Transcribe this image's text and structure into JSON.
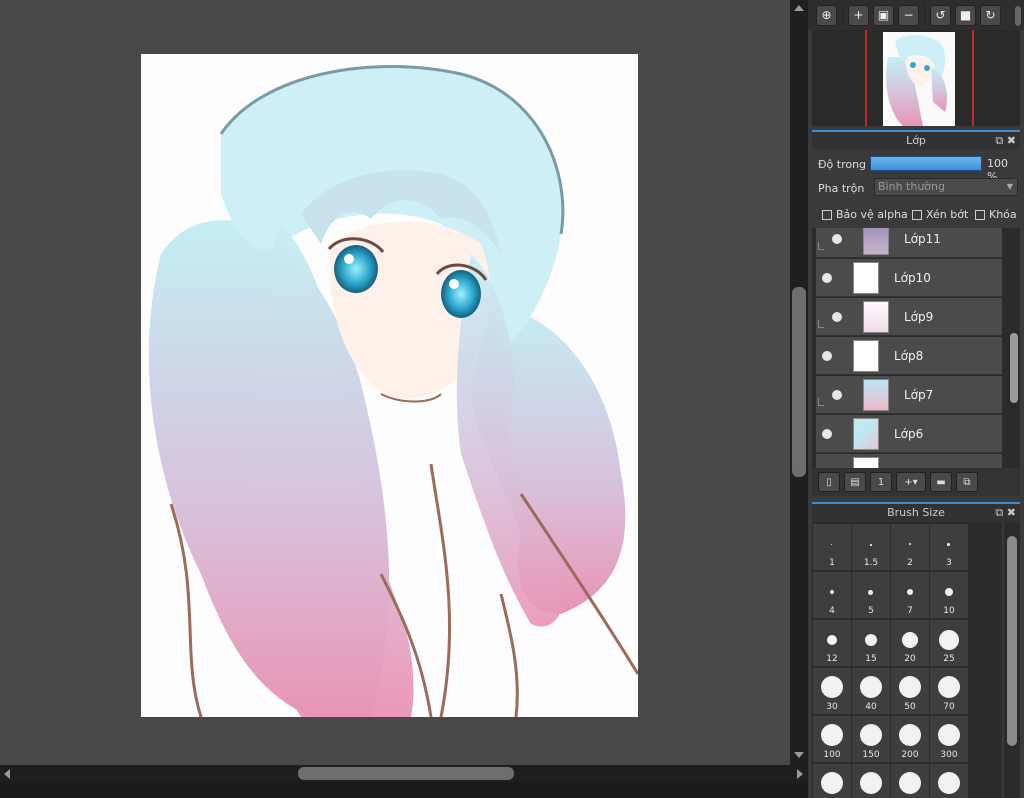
{
  "navigator": {
    "toolbar_icons": [
      "zoom-fit-icon",
      "zoom-in-icon",
      "fit-screen-icon",
      "zoom-out-icon",
      "rotate-left-icon",
      "full-view-icon",
      "rotate-right-icon"
    ]
  },
  "layer_panel": {
    "title": "Lớp",
    "opacity_label": "Độ trong",
    "opacity_value": "100 %",
    "opacity_fraction": 1.0,
    "blend_label": "Pha trộn",
    "blend_value": "Bình thường",
    "protect_alpha": "Bảo vệ alpha",
    "clipping": "Xén bớt",
    "lock": "Khóa",
    "layers": [
      {
        "name": "Lớp11",
        "clip": true,
        "thumb": "purple"
      },
      {
        "name": "Lớp10",
        "clip": false,
        "thumb": "checker"
      },
      {
        "name": "Lớp9",
        "clip": true,
        "thumb": "lightpink"
      },
      {
        "name": "Lớp8",
        "clip": false,
        "thumb": "checker"
      },
      {
        "name": "Lớp7",
        "clip": true,
        "thumb": "bluepink"
      },
      {
        "name": "Lớp6",
        "clip": false,
        "thumb": "art"
      }
    ]
  },
  "brush_panel": {
    "title": "Brush Size",
    "sizes": [
      "1",
      "1.5",
      "2",
      "3",
      "4",
      "5",
      "7",
      "10",
      "12",
      "15",
      "20",
      "25",
      "30",
      "40",
      "50",
      "70",
      "100",
      "150",
      "200",
      "300"
    ]
  },
  "colors": {
    "accent": "#3d8fcf",
    "canvas_bg": "#4a4847",
    "hair_top": "#bfe8f0",
    "hair_bottom": "#e79ab5",
    "outline": "#9c6b5a"
  }
}
